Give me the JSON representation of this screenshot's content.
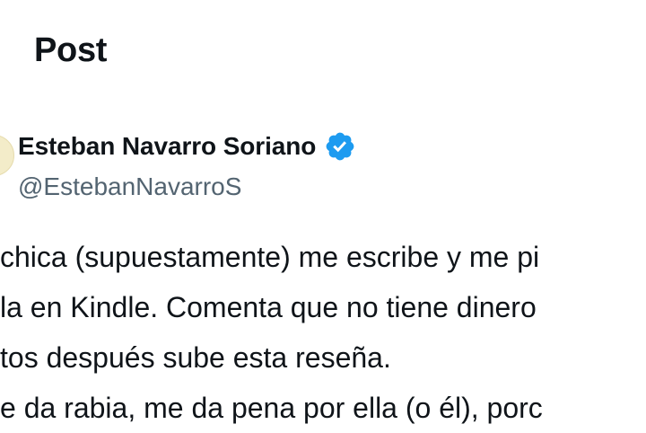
{
  "header": {
    "title": "Post"
  },
  "author": {
    "name": "Esteban Navarro Soriano",
    "handle": "@EstebanNavarroS",
    "verified": true,
    "verified_color": "#1d9bf0"
  },
  "post": {
    "lines": [
      "chica (supuestamente) me escribe y me pi",
      "la en Kindle. Comenta que no tiene dinero",
      "tos después sube esta reseña.",
      "e da rabia, me da pena por ella (o él), porc"
    ]
  },
  "icons": {
    "verified": "verified-badge-icon"
  }
}
